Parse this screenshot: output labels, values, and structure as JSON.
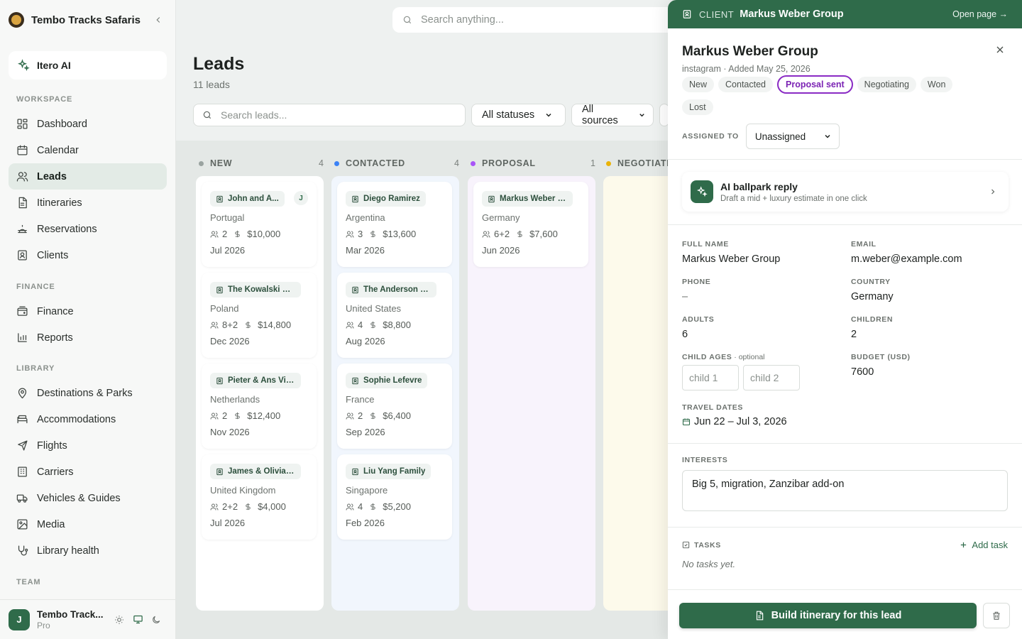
{
  "app": {
    "brand_name": "Tembo Tracks Safaris",
    "ai_button_label": "Itero AI",
    "global_search_placeholder": "Search anything..."
  },
  "sidebar": {
    "sections": [
      {
        "heading": "WORKSPACE",
        "items": [
          {
            "label": "Dashboard",
            "icon": "dashboard-icon"
          },
          {
            "label": "Calendar",
            "icon": "calendar-icon"
          },
          {
            "label": "Leads",
            "icon": "users-icon",
            "active": true
          },
          {
            "label": "Itineraries",
            "icon": "document-icon"
          },
          {
            "label": "Reservations",
            "icon": "bell-icon"
          },
          {
            "label": "Clients",
            "icon": "contact-icon"
          }
        ]
      },
      {
        "heading": "FINANCE",
        "items": [
          {
            "label": "Finance",
            "icon": "wallet-icon"
          },
          {
            "label": "Reports",
            "icon": "bar-chart-icon"
          }
        ]
      },
      {
        "heading": "LIBRARY",
        "items": [
          {
            "label": "Destinations & Parks",
            "icon": "map-pin-icon"
          },
          {
            "label": "Accommodations",
            "icon": "bed-icon"
          },
          {
            "label": "Flights",
            "icon": "plane-icon"
          },
          {
            "label": "Carriers",
            "icon": "building-icon"
          },
          {
            "label": "Vehicles & Guides",
            "icon": "truck-icon"
          },
          {
            "label": "Media",
            "icon": "image-icon"
          },
          {
            "label": "Library health",
            "icon": "stethoscope-icon"
          }
        ]
      },
      {
        "heading": "TEAM",
        "items": []
      }
    ],
    "user": {
      "initial": "J",
      "name": "Tembo Track...",
      "plan": "Pro"
    }
  },
  "page": {
    "title": "Leads",
    "count": "11 leads",
    "search_placeholder": "Search leads...",
    "status_filter": "All statuses",
    "source_filter": "All sources"
  },
  "columns": [
    {
      "title": "NEW",
      "count": "4",
      "color": "#9aa3a0",
      "bg": "#ffffff",
      "cards": [
        {
          "name": "John and A...",
          "badge": "J",
          "country": "Portugal",
          "party": "2",
          "budget": "$10,000",
          "date": "Jul 2026"
        },
        {
          "name": "The Kowalski Reu...",
          "country": "Poland",
          "party": "8+2",
          "budget": "$14,800",
          "date": "Dec 2026"
        },
        {
          "name": "Pieter & Ans Visser",
          "country": "Netherlands",
          "party": "2",
          "budget": "$12,400",
          "date": "Nov 2026"
        },
        {
          "name": "James & Olivia H...",
          "country": "United Kingdom",
          "party": "2+2",
          "budget": "$4,000",
          "date": "Jul 2026"
        }
      ]
    },
    {
      "title": "CONTACTED",
      "count": "4",
      "color": "#3b82f6",
      "bg": "#f1f6fd",
      "cards": [
        {
          "name": "Diego Ramirez",
          "country": "Argentina",
          "party": "3",
          "budget": "$13,600",
          "date": "Mar 2026"
        },
        {
          "name": "The Anderson Fa...",
          "country": "United States",
          "party": "4",
          "budget": "$8,800",
          "date": "Aug 2026"
        },
        {
          "name": "Sophie Lefevre",
          "country": "France",
          "party": "2",
          "budget": "$6,400",
          "date": "Sep 2026"
        },
        {
          "name": "Liu Yang Family",
          "country": "Singapore",
          "party": "4",
          "budget": "$5,200",
          "date": "Feb 2026"
        }
      ]
    },
    {
      "title": "PROPOSAL",
      "count": "1",
      "color": "#a855f7",
      "bg": "#f8f3fc",
      "cards": [
        {
          "name": "Markus Weber Gr...",
          "country": "Germany",
          "party": "6+2",
          "budget": "$7,600",
          "date": "Jun 2026"
        }
      ]
    },
    {
      "title": "NEGOTIATI",
      "count": "",
      "color": "#eab308",
      "bg": "#fdfaeb",
      "cards": []
    }
  ],
  "drawer": {
    "bar_kind": "CLIENT",
    "bar_name": "Markus Weber Group",
    "open_page": "Open page →",
    "title": "Markus Weber Group",
    "subtitle": "instagram · Added May 25, 2026",
    "stages": [
      "New",
      "Contacted",
      "Proposal sent",
      "Negotiating",
      "Won",
      "Lost"
    ],
    "active_stage": "Proposal sent",
    "assigned_label": "ASSIGNED TO",
    "assigned_value": "Unassigned",
    "ai": {
      "title": "AI ballpark reply",
      "subtitle": "Draft a mid + luxury estimate in one click"
    },
    "fields": {
      "full_name_label": "FULL NAME",
      "full_name": "Markus Weber Group",
      "email_label": "EMAIL",
      "email": "m.weber@example.com",
      "phone_label": "PHONE",
      "phone": "–",
      "country_label": "COUNTRY",
      "country": "Germany",
      "adults_label": "ADULTS",
      "adults": "6",
      "children_label": "CHILDREN",
      "children": "2",
      "child_ages_label": "CHILD AGES",
      "child_ages_optional": " · optional",
      "child_1_placeholder": "child 1",
      "child_2_placeholder": "child 2",
      "budget_label": "BUDGET (USD)",
      "budget": "7600",
      "dates_label": "TRAVEL DATES",
      "dates": "Jun 22 – Jul 3, 2026",
      "interests_label": "INTERESTS",
      "interests": "Big 5, migration, Zanzibar add-on"
    },
    "tasks_label": "TASKS",
    "add_task": "Add task",
    "no_tasks": "No tasks yet.",
    "build_button": "Build itinerary for this lead"
  }
}
